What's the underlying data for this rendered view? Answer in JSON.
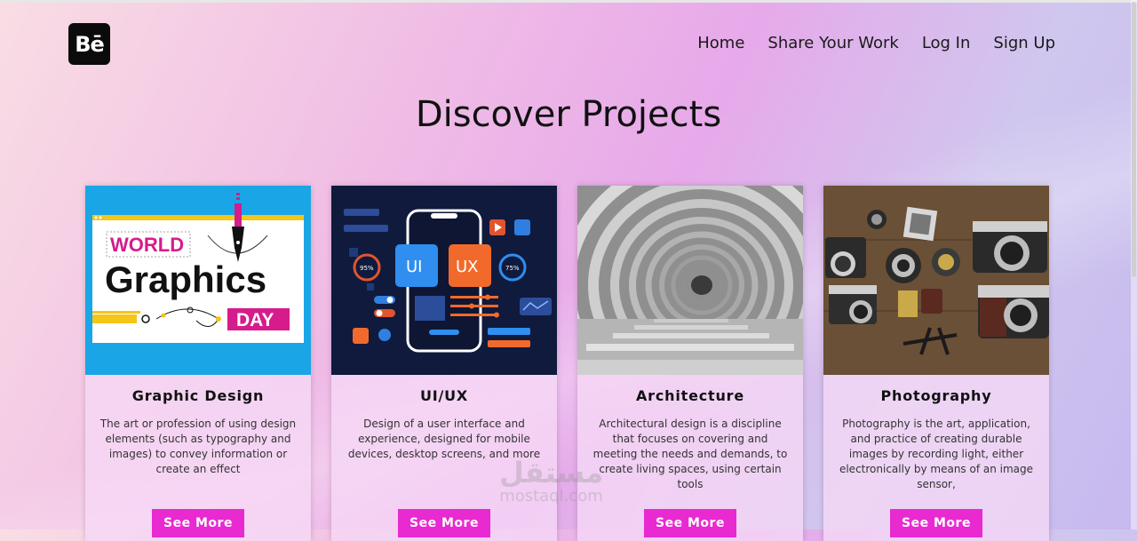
{
  "logo": {
    "text": "Bē"
  },
  "nav": {
    "items": [
      "Home",
      "Share Your Work",
      "Log In",
      "Sign Up"
    ]
  },
  "page_title": "Discover Projects",
  "cards": [
    {
      "title": "Graphic Design",
      "description": "The art or profession of using design elements (such as typography and images) to convey information or create an effect",
      "button": "See More",
      "image": {
        "line1": "WORLD",
        "line2": "Graphics",
        "line3": "DAY"
      }
    },
    {
      "title": "UI/UX",
      "description": "Design of a user interface and experience, designed for mobile devices, desktop screens, and more",
      "button": "See More",
      "image": {
        "left_label": "UI",
        "right_label": "UX",
        "left_pct": "95%",
        "right_pct": "75%"
      }
    },
    {
      "title": "Architecture",
      "description": "Architectural design is a discipline that focuses on covering and meeting the needs and demands, to create living spaces, using certain tools",
      "button": "See More",
      "image": {}
    },
    {
      "title": "Photography",
      "description": "Photography is the art, application, and practice of creating durable images by recording light, either electronically by means of an image sensor,",
      "button": "See More",
      "image": {}
    }
  ],
  "watermark": {
    "arabic": "مستقل",
    "latin": "mostaql.com"
  },
  "colors": {
    "accent": "#e82ad0",
    "logo_bg": "#0b0b0b",
    "card_bg": "#f6d8f6"
  }
}
